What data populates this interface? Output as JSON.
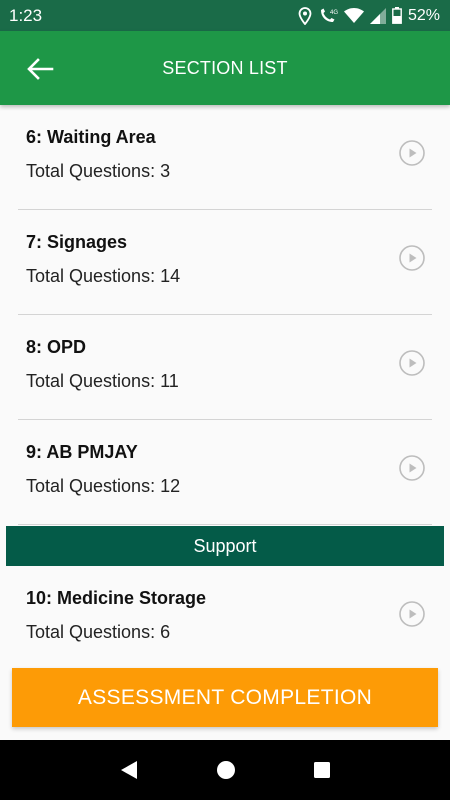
{
  "status_bar": {
    "time": "1:23",
    "battery": "52%",
    "icons": [
      "location-icon",
      "volte-call-icon",
      "wifi-icon",
      "cellular-signal-icon",
      "battery-icon"
    ]
  },
  "app_bar": {
    "title": "SECTION LIST",
    "back_icon": "arrow-left-icon"
  },
  "sections": [
    {
      "name": "6: Waiting Area",
      "count": "Total Questions: 3"
    },
    {
      "name": "7: Signages",
      "count": "Total Questions: 14"
    },
    {
      "name": "8: OPD",
      "count": "Total Questions: 11"
    },
    {
      "name": "9: AB PMJAY",
      "count": "Total Questions: 12"
    }
  ],
  "group": {
    "title": "Support",
    "sections": [
      {
        "name": "10: Medicine Storage",
        "count": "Total Questions: 6"
      }
    ]
  },
  "footer": {
    "complete_label": "ASSESSMENT COMPLETION"
  },
  "colors": {
    "status_bar": "#1a6b48",
    "app_bar": "#1e9747",
    "group_header": "#045b48",
    "action_button": "#fd9b06"
  }
}
